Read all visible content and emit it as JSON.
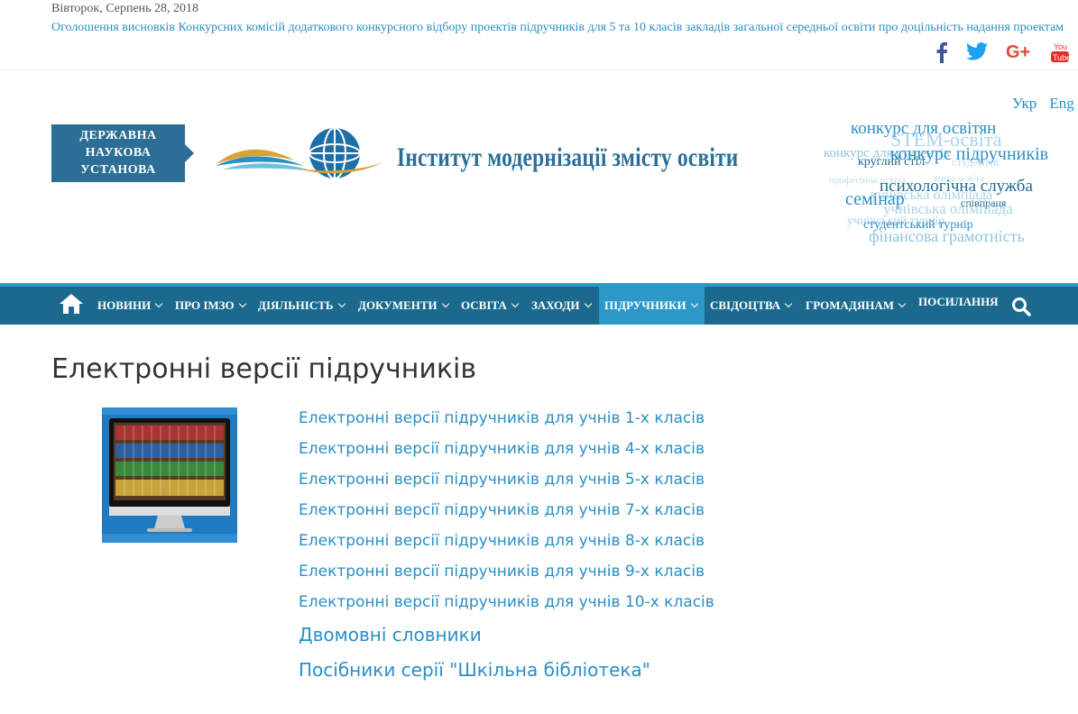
{
  "topbar": {
    "date": "Вівторок, Серпень 28, 2018",
    "ticker": "Оголошення висновків Конкурсних комісій додаткового конкурсного відбору проектів підручників для 5 та 10 класів закладів загальної середньої освіти про доцільність надання проектам",
    "social": [
      {
        "icon": "facebook-icon",
        "color": "#3b5998"
      },
      {
        "icon": "twitter-icon",
        "color": "#1da1f2"
      },
      {
        "icon": "google-plus-icon",
        "color": "#dd4b39"
      },
      {
        "icon": "youtube-icon",
        "color": "#e52d27",
        "label": "You Tube"
      }
    ]
  },
  "header": {
    "lang": [
      "Укр",
      "Eng"
    ],
    "badge_lines": [
      "ДЕРЖАВНА",
      "НАУКОВА",
      "УСТАНОВА"
    ],
    "site_title": "Інститут модернізації змісту освіти"
  },
  "tagcloud": [
    {
      "text": "конкурс для освітян",
      "size": 19,
      "color": "#2a8fc4"
    },
    {
      "text": "STEM-освіта",
      "size": 22,
      "color": "#a9d3ea"
    },
    {
      "text": "конкурс для студентів",
      "size": 15,
      "color": "#8fc3e0"
    },
    {
      "text": "конкурс підручників",
      "size": 20,
      "color": "#2a8fc4"
    },
    {
      "text": "круглий стіл",
      "size": 14,
      "color": "#1b6a8e"
    },
    {
      "text": "студентів",
      "size": 13,
      "color": "#bfe0f0"
    },
    {
      "text": "професійна освіта",
      "size": 11,
      "color": "#bfe0f0"
    },
    {
      "text": "вища освіта",
      "size": 11,
      "color": "#bfe0f0"
    },
    {
      "text": "психологічна служба",
      "size": 19,
      "color": "#1b6a8e"
    },
    {
      "text": "учнівська олімпіада",
      "size": 16,
      "color": "#a9d3ea"
    },
    {
      "text": "семінар",
      "size": 20,
      "color": "#2a8fc4"
    },
    {
      "text": "співпраця",
      "size": 12,
      "color": "#1b6a8e"
    },
    {
      "text": "учнівська олімпіада",
      "size": 17,
      "color": "#a9d3ea"
    },
    {
      "text": "учнівський турнір",
      "size": 14,
      "color": "#a9d3ea"
    },
    {
      "text": "студентський турнір",
      "size": 14,
      "color": "#2a8fc4"
    },
    {
      "text": "фінансова грамотність",
      "size": 18,
      "color": "#8fc3e0"
    }
  ],
  "nav": {
    "items": [
      {
        "label": "НОВИНИ",
        "caret": true
      },
      {
        "label": "ПРО ІМЗО",
        "caret": true
      },
      {
        "label": "ДІЯЛЬНІСТЬ",
        "caret": true
      },
      {
        "label": "ДОКУМЕНТИ",
        "caret": true
      },
      {
        "label": "ОСВІТА",
        "caret": true
      },
      {
        "label": "ЗАХОДИ",
        "caret": true
      },
      {
        "label": "ПІДРУЧНИКИ",
        "caret": true,
        "active": true
      },
      {
        "label": "СВІДОЦТВА",
        "caret": true
      },
      {
        "label": "ГРОМАДЯНАМ",
        "caret": true
      },
      {
        "label": "ПОСИЛАННЯ",
        "caret": false
      }
    ]
  },
  "content": {
    "title": "Електронні версії підручників",
    "links": [
      {
        "label": "Електронні версії підручників для учнів 1-х класів",
        "size": "small"
      },
      {
        "label": "Електронні версії підручників для учнів 4-х класів",
        "size": "small"
      },
      {
        "label": "Електронні версії підручників для учнів 5-х класів",
        "size": "small"
      },
      {
        "label": "Електронні версії підручників для учнів 7-х класів",
        "size": "small"
      },
      {
        "label": "Електронні версії підручників для учнів 8-х класів",
        "size": "small"
      },
      {
        "label": "Електронні версії підручників для учнів 9-х класів",
        "size": "small"
      },
      {
        "label": "Електронні версії підручників для учнів 10-х класів",
        "size": "small"
      },
      {
        "label": "Двомовні словники",
        "size": "big"
      },
      {
        "label": "Посібники серії \"Шкільна бібліотека\"",
        "size": "big"
      }
    ]
  }
}
